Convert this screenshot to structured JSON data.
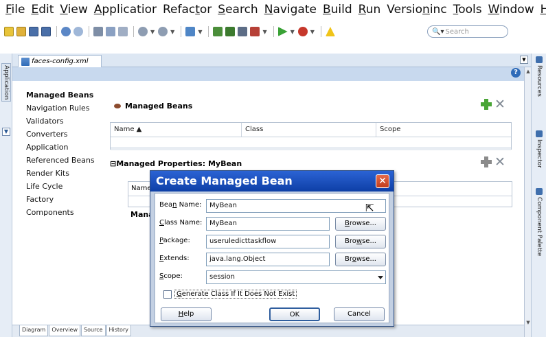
{
  "menu": [
    {
      "pre": "",
      "ul": "F",
      "post": "ile"
    },
    {
      "pre": "",
      "ul": "E",
      "post": "dit"
    },
    {
      "pre": "",
      "ul": "V",
      "post": "iew"
    },
    {
      "pre": "",
      "ul": "A",
      "post": "pplicatior"
    },
    {
      "pre": "Refac",
      "ul": "t",
      "post": "or"
    },
    {
      "pre": "",
      "ul": "S",
      "post": "earch"
    },
    {
      "pre": "",
      "ul": "N",
      "post": "avigate"
    },
    {
      "pre": "",
      "ul": "B",
      "post": "uild"
    },
    {
      "pre": "",
      "ul": "R",
      "post": "un"
    },
    {
      "pre": "Versio",
      "ul": "n",
      "post": "inc"
    },
    {
      "pre": "",
      "ul": "T",
      "post": "ools"
    },
    {
      "pre": "",
      "ul": "W",
      "post": "indow"
    },
    {
      "pre": "",
      "ul": "H",
      "post": "elp"
    }
  ],
  "search": {
    "placeholder": "Search"
  },
  "left_tabs": {
    "application": "Application"
  },
  "editor_tab": {
    "label": "faces-config.xml"
  },
  "nav": [
    "Managed Beans",
    "Navigation Rules",
    "Validators",
    "Converters",
    "Application",
    "Referenced Beans",
    "Render Kits",
    "Life Cycle",
    "Factory",
    "Components"
  ],
  "managed_beans": {
    "header": "Managed Beans",
    "columns": [
      "Name ▲",
      "Class",
      "Scope"
    ]
  },
  "managed_properties": {
    "header": "Managed Properties: MyBean",
    "column_first": "Name",
    "mana_label": "Mana"
  },
  "bottom_tabs": [
    "Diagram",
    "Overview",
    "Source",
    "History"
  ],
  "right_tabs": [
    "Resources",
    "Inspector",
    "Component Palette"
  ],
  "dialog": {
    "title": "Create Managed Bean",
    "fields": {
      "bean_name": {
        "label_pre": "Bea",
        "label_ul": "n",
        "label_post": " Name:",
        "value": "MyBean"
      },
      "class_name": {
        "label_pre": "",
        "label_ul": "C",
        "label_post": "lass Name:",
        "value": "MyBean"
      },
      "package": {
        "label_pre": "",
        "label_ul": "P",
        "label_post": "ackage:",
        "value": "useruledicttaskflow"
      },
      "extends": {
        "label_pre": "",
        "label_ul": "E",
        "label_post": "xtends:",
        "value": "java.lang.Object"
      },
      "scope": {
        "label_pre": "",
        "label_ul": "S",
        "label_post": "cope:",
        "value": "session"
      }
    },
    "browse_class": {
      "pre": "",
      "ul": "B",
      "post": "rowse..."
    },
    "browse_package": {
      "pre": "Bro",
      "ul": "w",
      "post": "se..."
    },
    "browse_extends": {
      "pre": "Br",
      "ul": "o",
      "post": "wse..."
    },
    "generate_label_pre": "",
    "generate_label_ul": "G",
    "generate_label_post": "enerate Class If It Does Not Exist",
    "generate_checked": false,
    "help_pre": "",
    "help_ul": "H",
    "help_post": "elp",
    "ok_label": "OK",
    "cancel_label": "Cancel"
  },
  "colors": {
    "title_bar": "#1f55c4",
    "editor_band": "#c8d9ee",
    "add_icon": "#49a536"
  },
  "icons": [
    "new-icon",
    "open-icon",
    "save-icon",
    "save-all-icon",
    "undo-icon",
    "redo-icon",
    "cut-icon",
    "copy-icon",
    "paste-icon",
    "back-icon",
    "forward-icon",
    "make-icon",
    "deploy-icon",
    "run-icon",
    "debug-icon",
    "warning-icon"
  ]
}
